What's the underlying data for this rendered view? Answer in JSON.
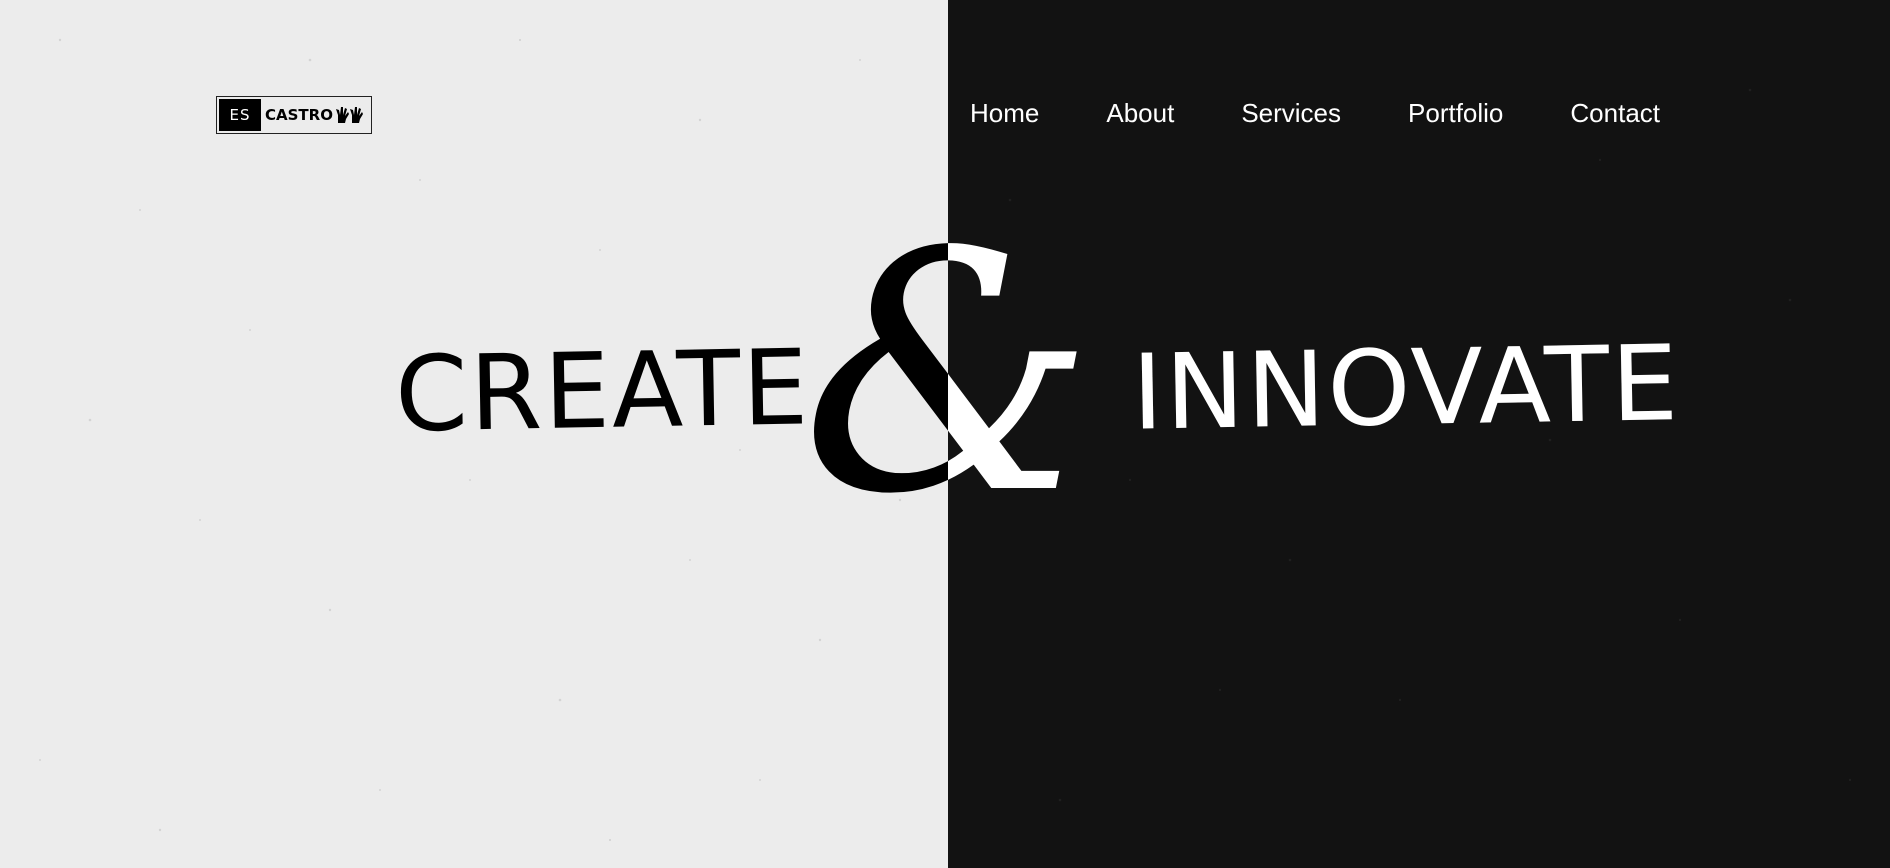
{
  "logo": {
    "initials": "ES",
    "name": "CASTRO"
  },
  "nav": {
    "items": [
      {
        "label": "Home"
      },
      {
        "label": "About"
      },
      {
        "label": "Services"
      },
      {
        "label": "Portfolio"
      },
      {
        "label": "Contact"
      }
    ]
  },
  "hero": {
    "left_word": "CREATE",
    "ampersand": "&",
    "right_word": "INNOVATE"
  },
  "colors": {
    "light_panel": "#ececec",
    "dark_panel": "#121212",
    "text_light": "#ffffff",
    "text_dark": "#000000"
  }
}
